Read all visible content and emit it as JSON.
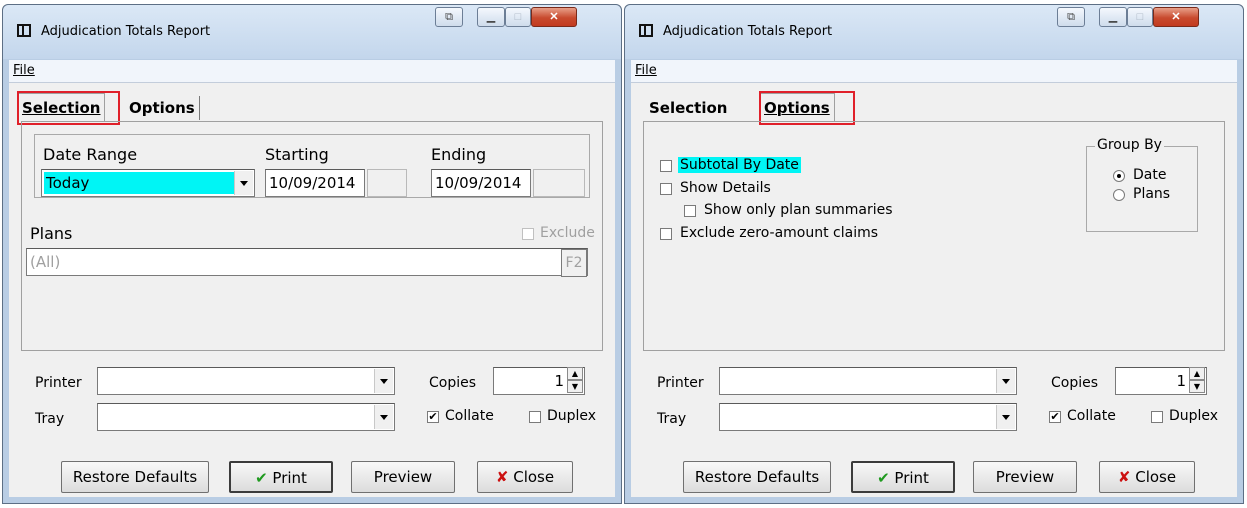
{
  "left": {
    "title": "Adjudication Totals Report",
    "menu_file": "File",
    "tabs": {
      "selection": "Selection",
      "options": "Options"
    },
    "date_range_label": "Date Range",
    "date_range_value": "Today",
    "starting_label": "Starting",
    "starting_value": "10/09/2014",
    "ending_label": "Ending",
    "ending_value": "10/09/2014",
    "plans_label": "Plans",
    "exclude_label": "Exclude",
    "plans_value": "(All)",
    "f2_label": "F2",
    "printer_label": "Printer",
    "tray_label": "Tray",
    "copies_label": "Copies",
    "copies_value": "1",
    "collate_label": "Collate",
    "duplex_label": "Duplex",
    "restore_label": "Restore Defaults",
    "print_label": "Print",
    "preview_label": "Preview",
    "close_label": "Close"
  },
  "right": {
    "title": "Adjudication Totals Report",
    "menu_file": "File",
    "tabs": {
      "selection": "Selection",
      "options": "Options"
    },
    "subtotal_label": "Subtotal By Date",
    "show_details_label": "Show Details",
    "show_plan_summaries_label": "Show only plan summaries",
    "exclude_zero_label": "Exclude zero-amount claims",
    "group_by_label": "Group By",
    "group_date_label": "Date",
    "group_plans_label": "Plans",
    "printer_label": "Printer",
    "tray_label": "Tray",
    "copies_label": "Copies",
    "copies_value": "1",
    "collate_label": "Collate",
    "duplex_label": "Duplex",
    "restore_label": "Restore Defaults",
    "print_label": "Print",
    "preview_label": "Preview",
    "close_label": "Close"
  },
  "colors": {
    "highlight": "#00f5f5",
    "callout": "#e0202a",
    "titlebar": "#c3d6ec",
    "close_button": "#c84a2e"
  },
  "icons": [
    "app-window-icon",
    "extra-titlebar-icon",
    "minimize-icon",
    "maximize-icon",
    "close-icon",
    "green-checkmark-icon",
    "red-x-icon",
    "dropdown-arrow-icon",
    "spin-up-icon",
    "spin-down-icon"
  ]
}
